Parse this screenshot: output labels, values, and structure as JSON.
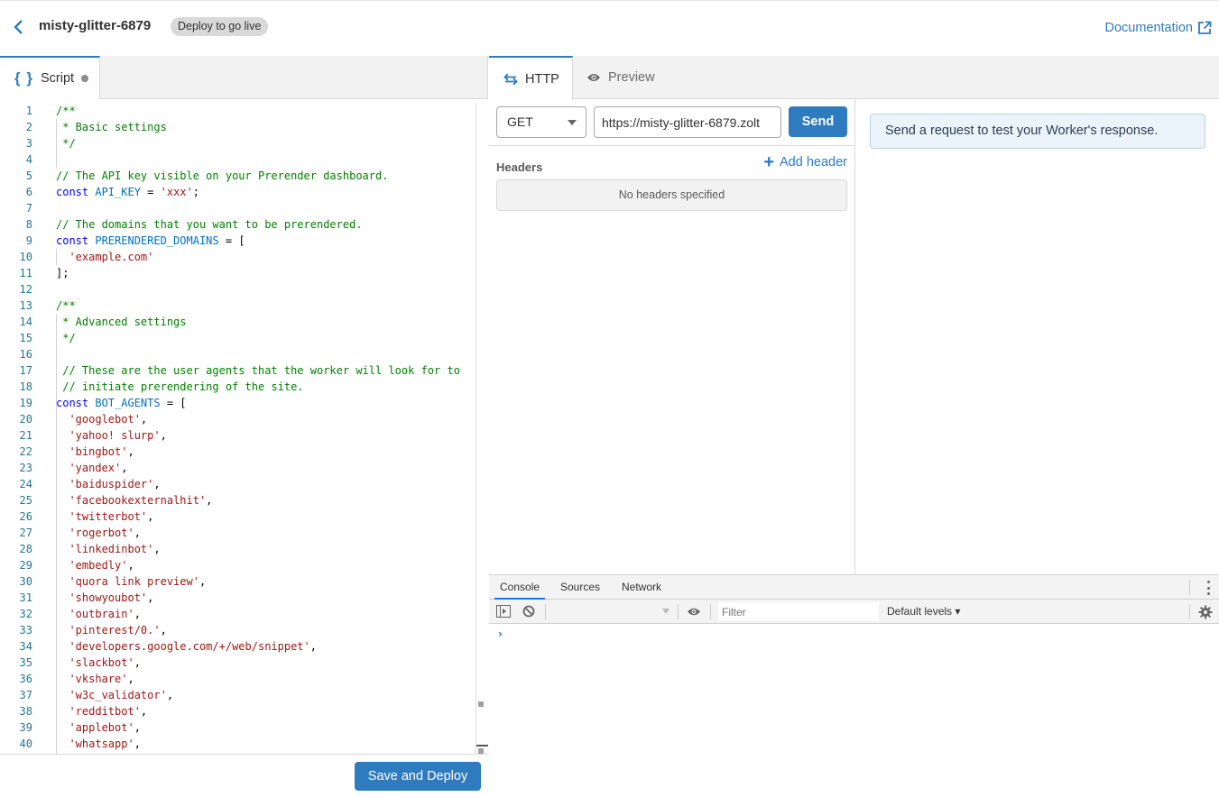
{
  "header": {
    "project_name": "misty-glitter-6879",
    "badge": "Deploy to go live",
    "documentation_label": "Documentation",
    "accent_color": "#2f7bbf"
  },
  "editor": {
    "tab_label": "Script",
    "tab_icon": "braces-icon",
    "unsaved_indicator": true,
    "save_button_label": "Save and Deploy",
    "lines": [
      {
        "n": "1",
        "segments": [
          {
            "t": "/**",
            "c": "comment"
          }
        ]
      },
      {
        "n": "2",
        "segments": [
          {
            "t": " * Basic settings",
            "c": "comment"
          }
        ]
      },
      {
        "n": "3",
        "segments": [
          {
            "t": " */",
            "c": "comment"
          }
        ]
      },
      {
        "n": "4",
        "segments": []
      },
      {
        "n": "5",
        "segments": [
          {
            "t": "// The API key visible on your Prerender dashboard.",
            "c": "comment"
          }
        ]
      },
      {
        "n": "6",
        "segments": [
          {
            "t": "const",
            "c": "kw"
          },
          {
            "t": " ",
            "c": "punct"
          },
          {
            "t": "API_KEY",
            "c": "const"
          },
          {
            "t": " = ",
            "c": "punct"
          },
          {
            "t": "'xxx'",
            "c": "str"
          },
          {
            "t": ";",
            "c": "punct"
          }
        ]
      },
      {
        "n": "7",
        "segments": []
      },
      {
        "n": "8",
        "segments": [
          {
            "t": "// The domains that you want to be prerendered.",
            "c": "comment"
          }
        ]
      },
      {
        "n": "9",
        "segments": [
          {
            "t": "const",
            "c": "kw"
          },
          {
            "t": " ",
            "c": "punct"
          },
          {
            "t": "PRERENDERED_DOMAINS",
            "c": "const"
          },
          {
            "t": " = [",
            "c": "punct"
          }
        ]
      },
      {
        "n": "10",
        "segments": [
          {
            "t": "  'example.com'",
            "c": "str"
          }
        ]
      },
      {
        "n": "11",
        "segments": [
          {
            "t": "];",
            "c": "punct"
          }
        ]
      },
      {
        "n": "12",
        "segments": []
      },
      {
        "n": "13",
        "segments": [
          {
            "t": "/**",
            "c": "comment"
          }
        ]
      },
      {
        "n": "14",
        "segments": [
          {
            "t": " * Advanced settings",
            "c": "comment"
          }
        ]
      },
      {
        "n": "15",
        "segments": [
          {
            "t": " */",
            "c": "comment"
          }
        ]
      },
      {
        "n": "16",
        "segments": []
      },
      {
        "n": "17",
        "segments": [
          {
            "t": " // These are the user agents that the worker will look for to",
            "c": "comment"
          }
        ]
      },
      {
        "n": "18",
        "segments": [
          {
            "t": " // initiate prerendering of the site.",
            "c": "comment"
          }
        ]
      },
      {
        "n": "19",
        "segments": [
          {
            "t": "const",
            "c": "kw"
          },
          {
            "t": " ",
            "c": "punct"
          },
          {
            "t": "BOT_AGENTS",
            "c": "const"
          },
          {
            "t": " = [",
            "c": "punct"
          }
        ]
      },
      {
        "n": "20",
        "segments": [
          {
            "t": "  'googlebot'",
            "c": "str"
          },
          {
            "t": ",",
            "c": "punct"
          }
        ]
      },
      {
        "n": "21",
        "segments": [
          {
            "t": "  'yahoo! slurp'",
            "c": "str"
          },
          {
            "t": ",",
            "c": "punct"
          }
        ]
      },
      {
        "n": "22",
        "segments": [
          {
            "t": "  'bingbot'",
            "c": "str"
          },
          {
            "t": ",",
            "c": "punct"
          }
        ]
      },
      {
        "n": "23",
        "segments": [
          {
            "t": "  'yandex'",
            "c": "str"
          },
          {
            "t": ",",
            "c": "punct"
          }
        ]
      },
      {
        "n": "24",
        "segments": [
          {
            "t": "  'baiduspider'",
            "c": "str"
          },
          {
            "t": ",",
            "c": "punct"
          }
        ]
      },
      {
        "n": "25",
        "segments": [
          {
            "t": "  'facebookexternalhit'",
            "c": "str"
          },
          {
            "t": ",",
            "c": "punct"
          }
        ]
      },
      {
        "n": "26",
        "segments": [
          {
            "t": "  'twitterbot'",
            "c": "str"
          },
          {
            "t": ",",
            "c": "punct"
          }
        ]
      },
      {
        "n": "27",
        "segments": [
          {
            "t": "  'rogerbot'",
            "c": "str"
          },
          {
            "t": ",",
            "c": "punct"
          }
        ]
      },
      {
        "n": "28",
        "segments": [
          {
            "t": "  'linkedinbot'",
            "c": "str"
          },
          {
            "t": ",",
            "c": "punct"
          }
        ]
      },
      {
        "n": "29",
        "segments": [
          {
            "t": "  'embedly'",
            "c": "str"
          },
          {
            "t": ",",
            "c": "punct"
          }
        ]
      },
      {
        "n": "30",
        "segments": [
          {
            "t": "  'quora link preview'",
            "c": "str"
          },
          {
            "t": ",",
            "c": "punct"
          }
        ]
      },
      {
        "n": "31",
        "segments": [
          {
            "t": "  'showyoubot'",
            "c": "str"
          },
          {
            "t": ",",
            "c": "punct"
          }
        ]
      },
      {
        "n": "32",
        "segments": [
          {
            "t": "  'outbrain'",
            "c": "str"
          },
          {
            "t": ",",
            "c": "punct"
          }
        ]
      },
      {
        "n": "33",
        "segments": [
          {
            "t": "  'pinterest/0.'",
            "c": "str"
          },
          {
            "t": ",",
            "c": "punct"
          }
        ]
      },
      {
        "n": "34",
        "segments": [
          {
            "t": "  'developers.google.com/+/web/snippet'",
            "c": "str"
          },
          {
            "t": ",",
            "c": "punct"
          }
        ]
      },
      {
        "n": "35",
        "segments": [
          {
            "t": "  'slackbot'",
            "c": "str"
          },
          {
            "t": ",",
            "c": "punct"
          }
        ]
      },
      {
        "n": "36",
        "segments": [
          {
            "t": "  'vkshare'",
            "c": "str"
          },
          {
            "t": ",",
            "c": "punct"
          }
        ]
      },
      {
        "n": "37",
        "segments": [
          {
            "t": "  'w3c_validator'",
            "c": "str"
          },
          {
            "t": ",",
            "c": "punct"
          }
        ]
      },
      {
        "n": "38",
        "segments": [
          {
            "t": "  'redditbot'",
            "c": "str"
          },
          {
            "t": ",",
            "c": "punct"
          }
        ]
      },
      {
        "n": "39",
        "segments": [
          {
            "t": "  'applebot'",
            "c": "str"
          },
          {
            "t": ",",
            "c": "punct"
          }
        ]
      },
      {
        "n": "40",
        "segments": [
          {
            "t": "  'whatsapp'",
            "c": "str"
          },
          {
            "t": ",",
            "c": "punct"
          }
        ]
      }
    ]
  },
  "http": {
    "tabs": [
      {
        "label": "HTTP",
        "icon": "arrows-swap-icon",
        "active": true
      },
      {
        "label": "Preview",
        "icon": "eye-icon",
        "active": false
      }
    ],
    "method": "GET",
    "url": "https://misty-glitter-6879.zolt",
    "send_label": "Send",
    "headers_label": "Headers",
    "add_header_label": "Add header",
    "no_headers_text": "No headers specified",
    "response_placeholder": "Send a request to test your Worker's response."
  },
  "devtools": {
    "tabs": [
      {
        "label": "Console",
        "active": true
      },
      {
        "label": "Sources",
        "active": false
      },
      {
        "label": "Network",
        "active": false
      }
    ],
    "filter_placeholder": "Filter",
    "levels_label": "Default levels ▾",
    "prompt": "›"
  }
}
